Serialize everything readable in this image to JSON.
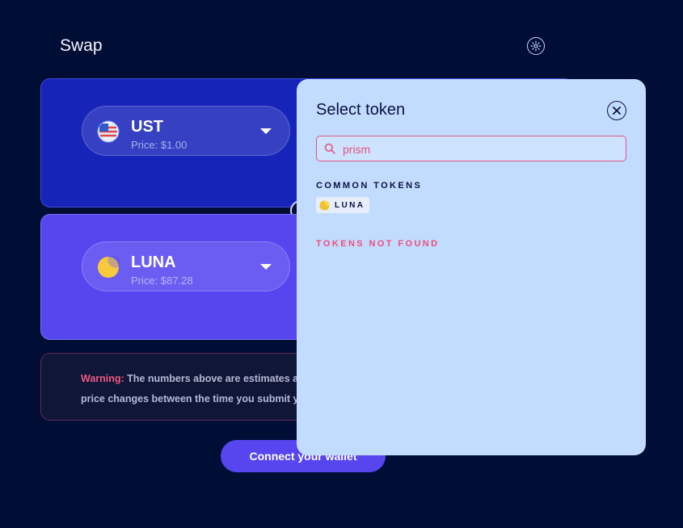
{
  "header": {
    "title": "Swap"
  },
  "from_panel": {
    "symbol": "UST",
    "price": "Price: $1.00"
  },
  "to_panel": {
    "symbol": "LUNA",
    "price": "Price: $87.28"
  },
  "warning": {
    "label": "Warning:",
    "text": " The numbers above are estimates and may differ from the final amounts due to price changes between the time you submit your transaction and when it is processed."
  },
  "connect_button": {
    "label": "Connect your wallet"
  },
  "modal": {
    "title": "Select token",
    "search": {
      "value": "prism",
      "placeholder": ""
    },
    "common_tokens_label": "COMMON TOKENS",
    "common_tokens": [
      {
        "symbol": "LUNA",
        "icon": "luna-icon"
      }
    ],
    "not_found_text": "TOKENS NOT FOUND"
  },
  "colors": {
    "background": "#000d35",
    "from_panel": "#1724b9",
    "to_panel": "#5746f0",
    "modal": "#c2dcff",
    "warning_accent": "#f0597f"
  },
  "icons": [
    "gear-icon",
    "ust-flag-icon",
    "luna-icon",
    "chevron-down-icon",
    "swap-direction-icon",
    "close-icon",
    "search-icon"
  ]
}
